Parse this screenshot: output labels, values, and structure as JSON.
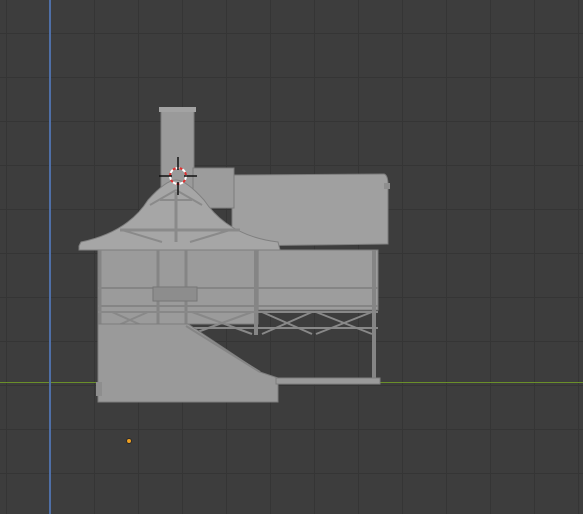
{
  "viewport": {
    "view": "3d-viewport",
    "background_color": "#3d3d3d",
    "grid_color": "#353535",
    "x_axis_color": "#6a8f2a",
    "z_axis_color": "#4f6fa6",
    "model_color": "#9a9a9a",
    "model": "house-mesh",
    "cursor_icon": "3d-cursor-icon",
    "origin_icon": "object-origin-icon",
    "origin_color": "#f0a020"
  }
}
